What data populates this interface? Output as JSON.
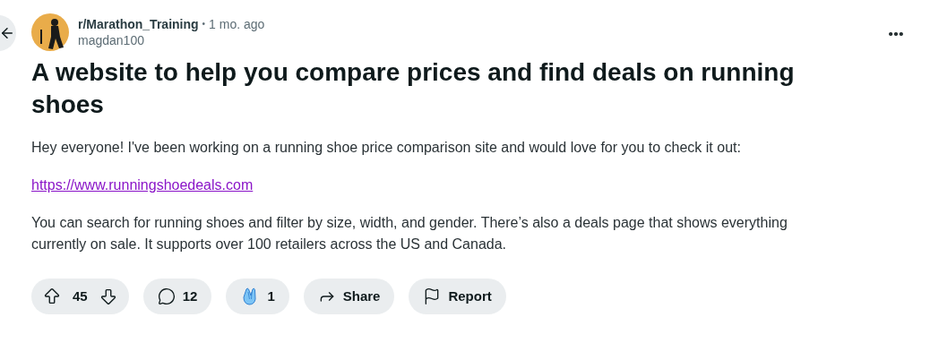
{
  "post": {
    "community": "r/Marathon_Training",
    "separator": "•",
    "age": "1 mo. ago",
    "author": "magdan100",
    "title": "A website to help you compare prices and find deals on running shoes",
    "paragraphs": [
      {
        "kind": "text",
        "text": "Hey everyone! I've been working on a running shoe price comparison site and would love for you to check it out:"
      },
      {
        "kind": "link",
        "text": "https://www.runningshoedeals.com"
      },
      {
        "kind": "text",
        "text": "You can search for running shoes and filter by size, width, and gender. There’s also a deals page that shows everything currently on sale. It supports over 100 retailers across the US and Canada."
      }
    ]
  },
  "actions": [
    {
      "kind": "vote",
      "count": "45"
    },
    {
      "kind": "comments",
      "count": "12"
    },
    {
      "kind": "award",
      "count": "1"
    },
    {
      "kind": "share",
      "label": "Share"
    },
    {
      "kind": "report",
      "label": "Report"
    }
  ]
}
